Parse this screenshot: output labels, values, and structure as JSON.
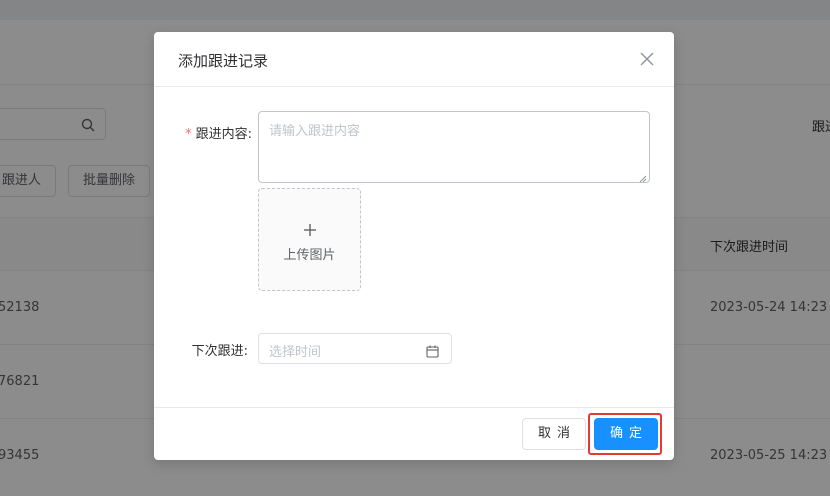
{
  "background": {
    "search_icon": "search-icon",
    "followers_button": "跟进人",
    "batch_delete_button": "批量删除",
    "right_label": "跟进",
    "column_header": "下次跟进时间",
    "rows": [
      {
        "id": "52138",
        "next_time": "2023-05-24 14:23"
      },
      {
        "id": "76821",
        "next_time": ""
      },
      {
        "id": "93455",
        "next_time": "2023-05-25 14:23"
      }
    ]
  },
  "dialog": {
    "title": "添加跟进记录",
    "close_icon": "close-icon",
    "content_label": "跟进内容:",
    "content_required_mark": "*",
    "content_value": "",
    "content_placeholder": "请输入跟进内容",
    "upload_icon": "plus-icon",
    "upload_label": "上传图片",
    "next_label": "下次跟进:",
    "next_placeholder": "选择时间",
    "calendar_icon": "calendar-icon",
    "cancel_label": "取消",
    "confirm_label": "确定"
  },
  "colors": {
    "primary": "#1890ff",
    "required": "#f56c6c",
    "highlight": "#e53935"
  }
}
